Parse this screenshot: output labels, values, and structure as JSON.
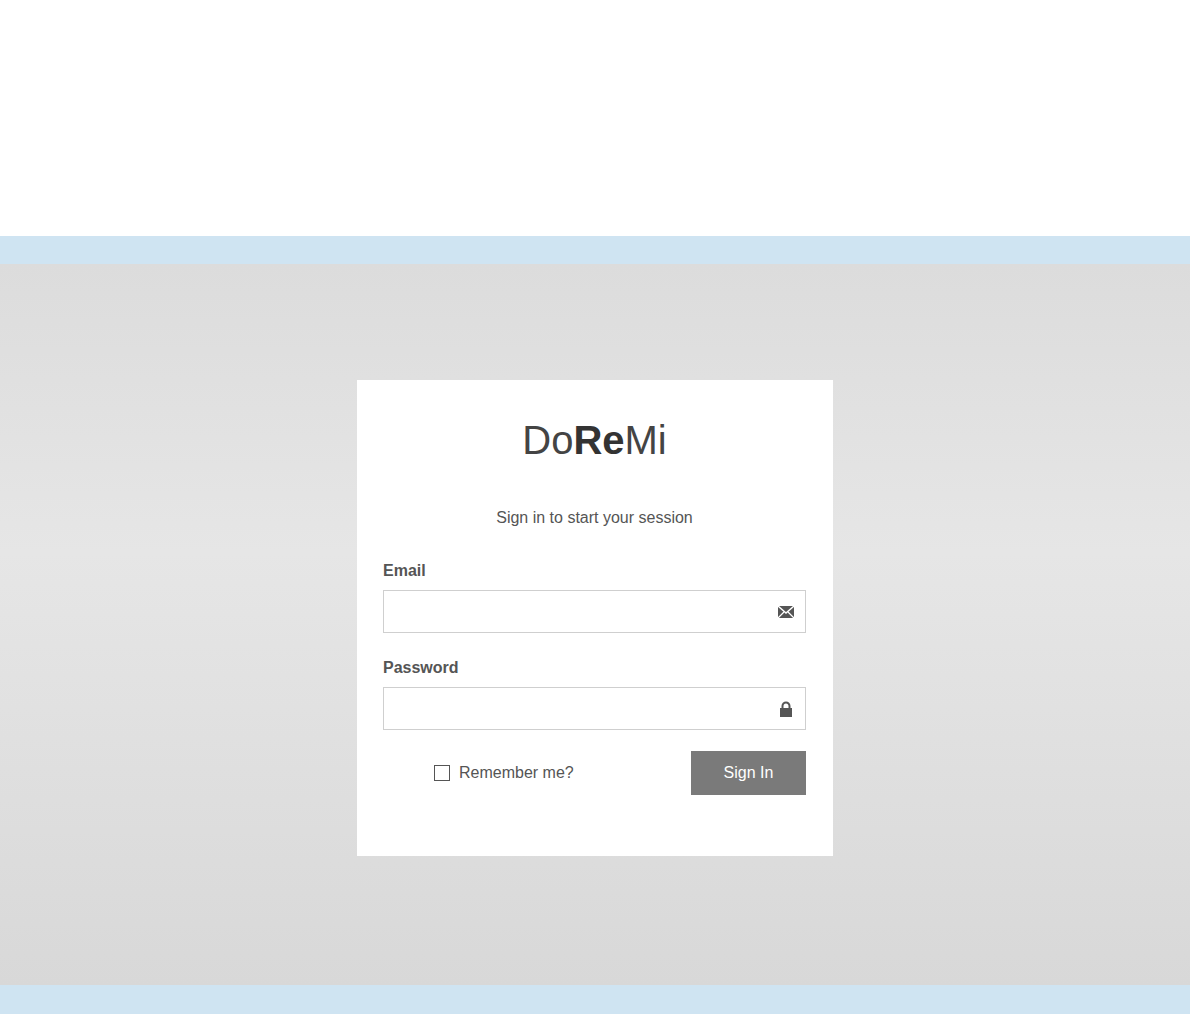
{
  "logo": [
    {
      "text": "Do",
      "bold": false
    },
    {
      "text": "Re",
      "bold": true
    },
    {
      "text": "Mi",
      "bold": false
    }
  ],
  "subtitle": "Sign in to start your session",
  "email": {
    "label": "Email"
  },
  "password": {
    "label": "Password"
  },
  "remember": {
    "label": "Remember me?",
    "checked": false
  },
  "sign_in": {
    "label": "Sign In"
  }
}
